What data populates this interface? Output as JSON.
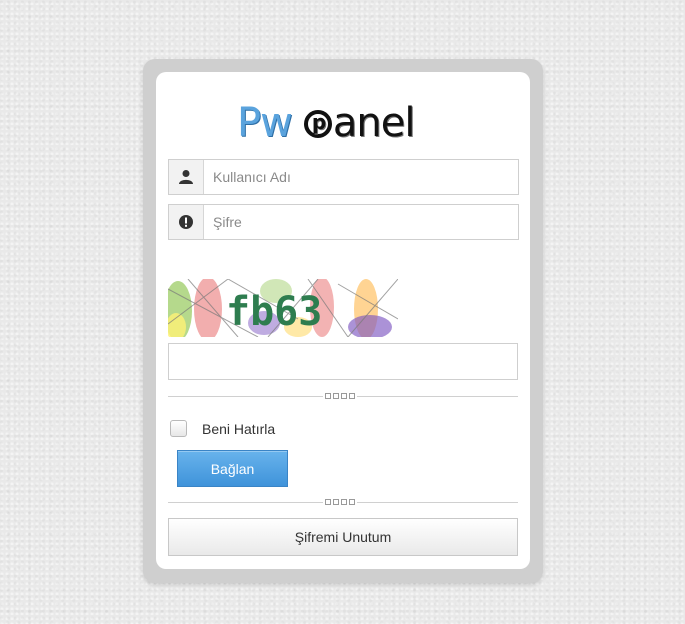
{
  "logo": {
    "part1": "Pw",
    "part2": "anel"
  },
  "login": {
    "username_placeholder": "Kullanıcı Adı",
    "password_placeholder": "Şifre",
    "captcha_text": "fb63",
    "captcha_placeholder": "",
    "remember_label": "Beni Hatırla",
    "login_button": "Bağlan",
    "forgot_button": "Şifremi Unutum"
  },
  "colors": {
    "accent": "#4a9fe0",
    "logo_blue": "#5aa3dd",
    "captcha_text": "#2e7d4f"
  },
  "icons": {
    "username": "user-icon",
    "password": "exclamation-circle-icon"
  }
}
